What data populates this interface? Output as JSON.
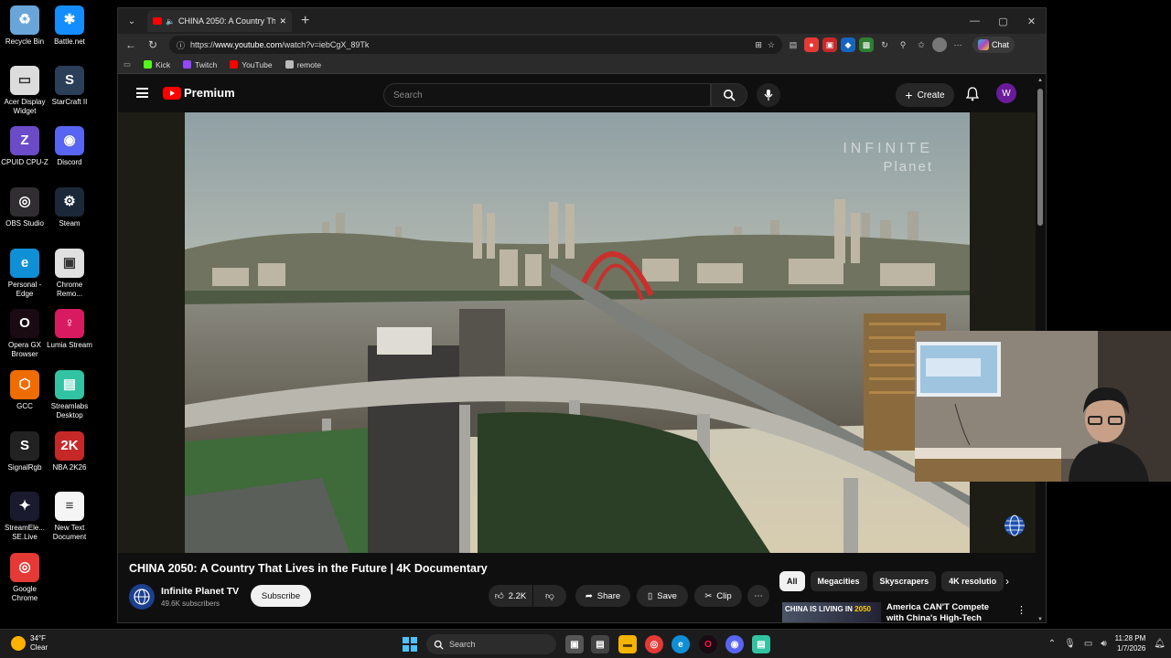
{
  "desktop_icons": [
    {
      "label": "Recycle Bin",
      "color": "#6aa5d9",
      "glyph": "♻"
    },
    {
      "label": "Battle.net",
      "color": "#148eff",
      "glyph": "✱"
    },
    {
      "label": "Acer Display Widget",
      "color": "#dcdcdc",
      "glyph": "▭"
    },
    {
      "label": "StarCraft II",
      "color": "#2b3f59",
      "glyph": "S"
    },
    {
      "label": "CPUID CPU-Z",
      "color": "#6b4bc8",
      "glyph": "Z"
    },
    {
      "label": "Discord",
      "color": "#5865f2",
      "glyph": "◉"
    },
    {
      "label": "OBS Studio",
      "color": "#302e31",
      "glyph": "◎"
    },
    {
      "label": "Steam",
      "color": "#1b2838",
      "glyph": "⚙"
    },
    {
      "label": "Personal - Edge",
      "color": "#0f8fd6",
      "glyph": "e"
    },
    {
      "label": "Chrome Remo...",
      "color": "#e0e0e0",
      "glyph": "▣"
    },
    {
      "label": "Opera GX Browser",
      "color": "#1a0a12",
      "glyph": "O"
    },
    {
      "label": "Lumia Stream",
      "color": "#d81b60",
      "glyph": "♀"
    },
    {
      "label": "GCC",
      "color": "#ef6c00",
      "glyph": "⬡"
    },
    {
      "label": "Streamlabs Desktop",
      "color": "#31c3a2",
      "glyph": "▤"
    },
    {
      "label": "SignalRgb",
      "color": "#222",
      "glyph": "S"
    },
    {
      "label": "NBA 2K26",
      "color": "#c62828",
      "glyph": "2K"
    },
    {
      "label": "StreamEle... SE.Live",
      "color": "#1a1a2e",
      "glyph": "✦"
    },
    {
      "label": "New Text Document",
      "color": "#f5f5f5",
      "glyph": "≡"
    },
    {
      "label": "Google Chrome",
      "color": "#e53935",
      "glyph": "◎"
    }
  ],
  "browser": {
    "tab_title": "CHINA 2050: A Country That L",
    "url_prefix": "https://",
    "url_host": "www.youtube.com",
    "url_path": "/watch?v=iebCgX_89Tk",
    "chat_label": "Chat",
    "bookmarks": [
      {
        "label": "Kick",
        "color": "#53fc18"
      },
      {
        "label": "Twitch",
        "color": "#9146ff"
      },
      {
        "label": "YouTube",
        "color": "#ff0000"
      },
      {
        "label": "remote",
        "color": "#bbbbbb"
      }
    ]
  },
  "youtube": {
    "logo_text": "Premium",
    "search_placeholder": "Search",
    "create_label": "Create",
    "avatar_letter": "W",
    "watermark_line1": "INFINITE",
    "watermark_line2": "Planet",
    "video_title": "CHINA 2050: A Country That Lives in the Future | 4K Documentary",
    "channel_name": "Infinite Planet TV",
    "channel_subs": "49.6K subscribers",
    "subscribe_label": "Subscribe",
    "like_count": "2.2K",
    "share_label": "Share",
    "save_label": "Save",
    "clip_label": "Clip",
    "chips": [
      "All",
      "Megacities",
      "Skyscrapers",
      "4K resolutio"
    ],
    "rec_thumb_text_a": "CHINA IS LIVING IN",
    "rec_thumb_text_b": "2050",
    "rec_title": "America CAN'T Compete with China's High-Tech Future! cy..."
  },
  "taskbar": {
    "weather_temp": "34°F",
    "weather_desc": "Clear",
    "search_label": "Search",
    "time": "11:28 PM",
    "date": "1/7/2026"
  }
}
